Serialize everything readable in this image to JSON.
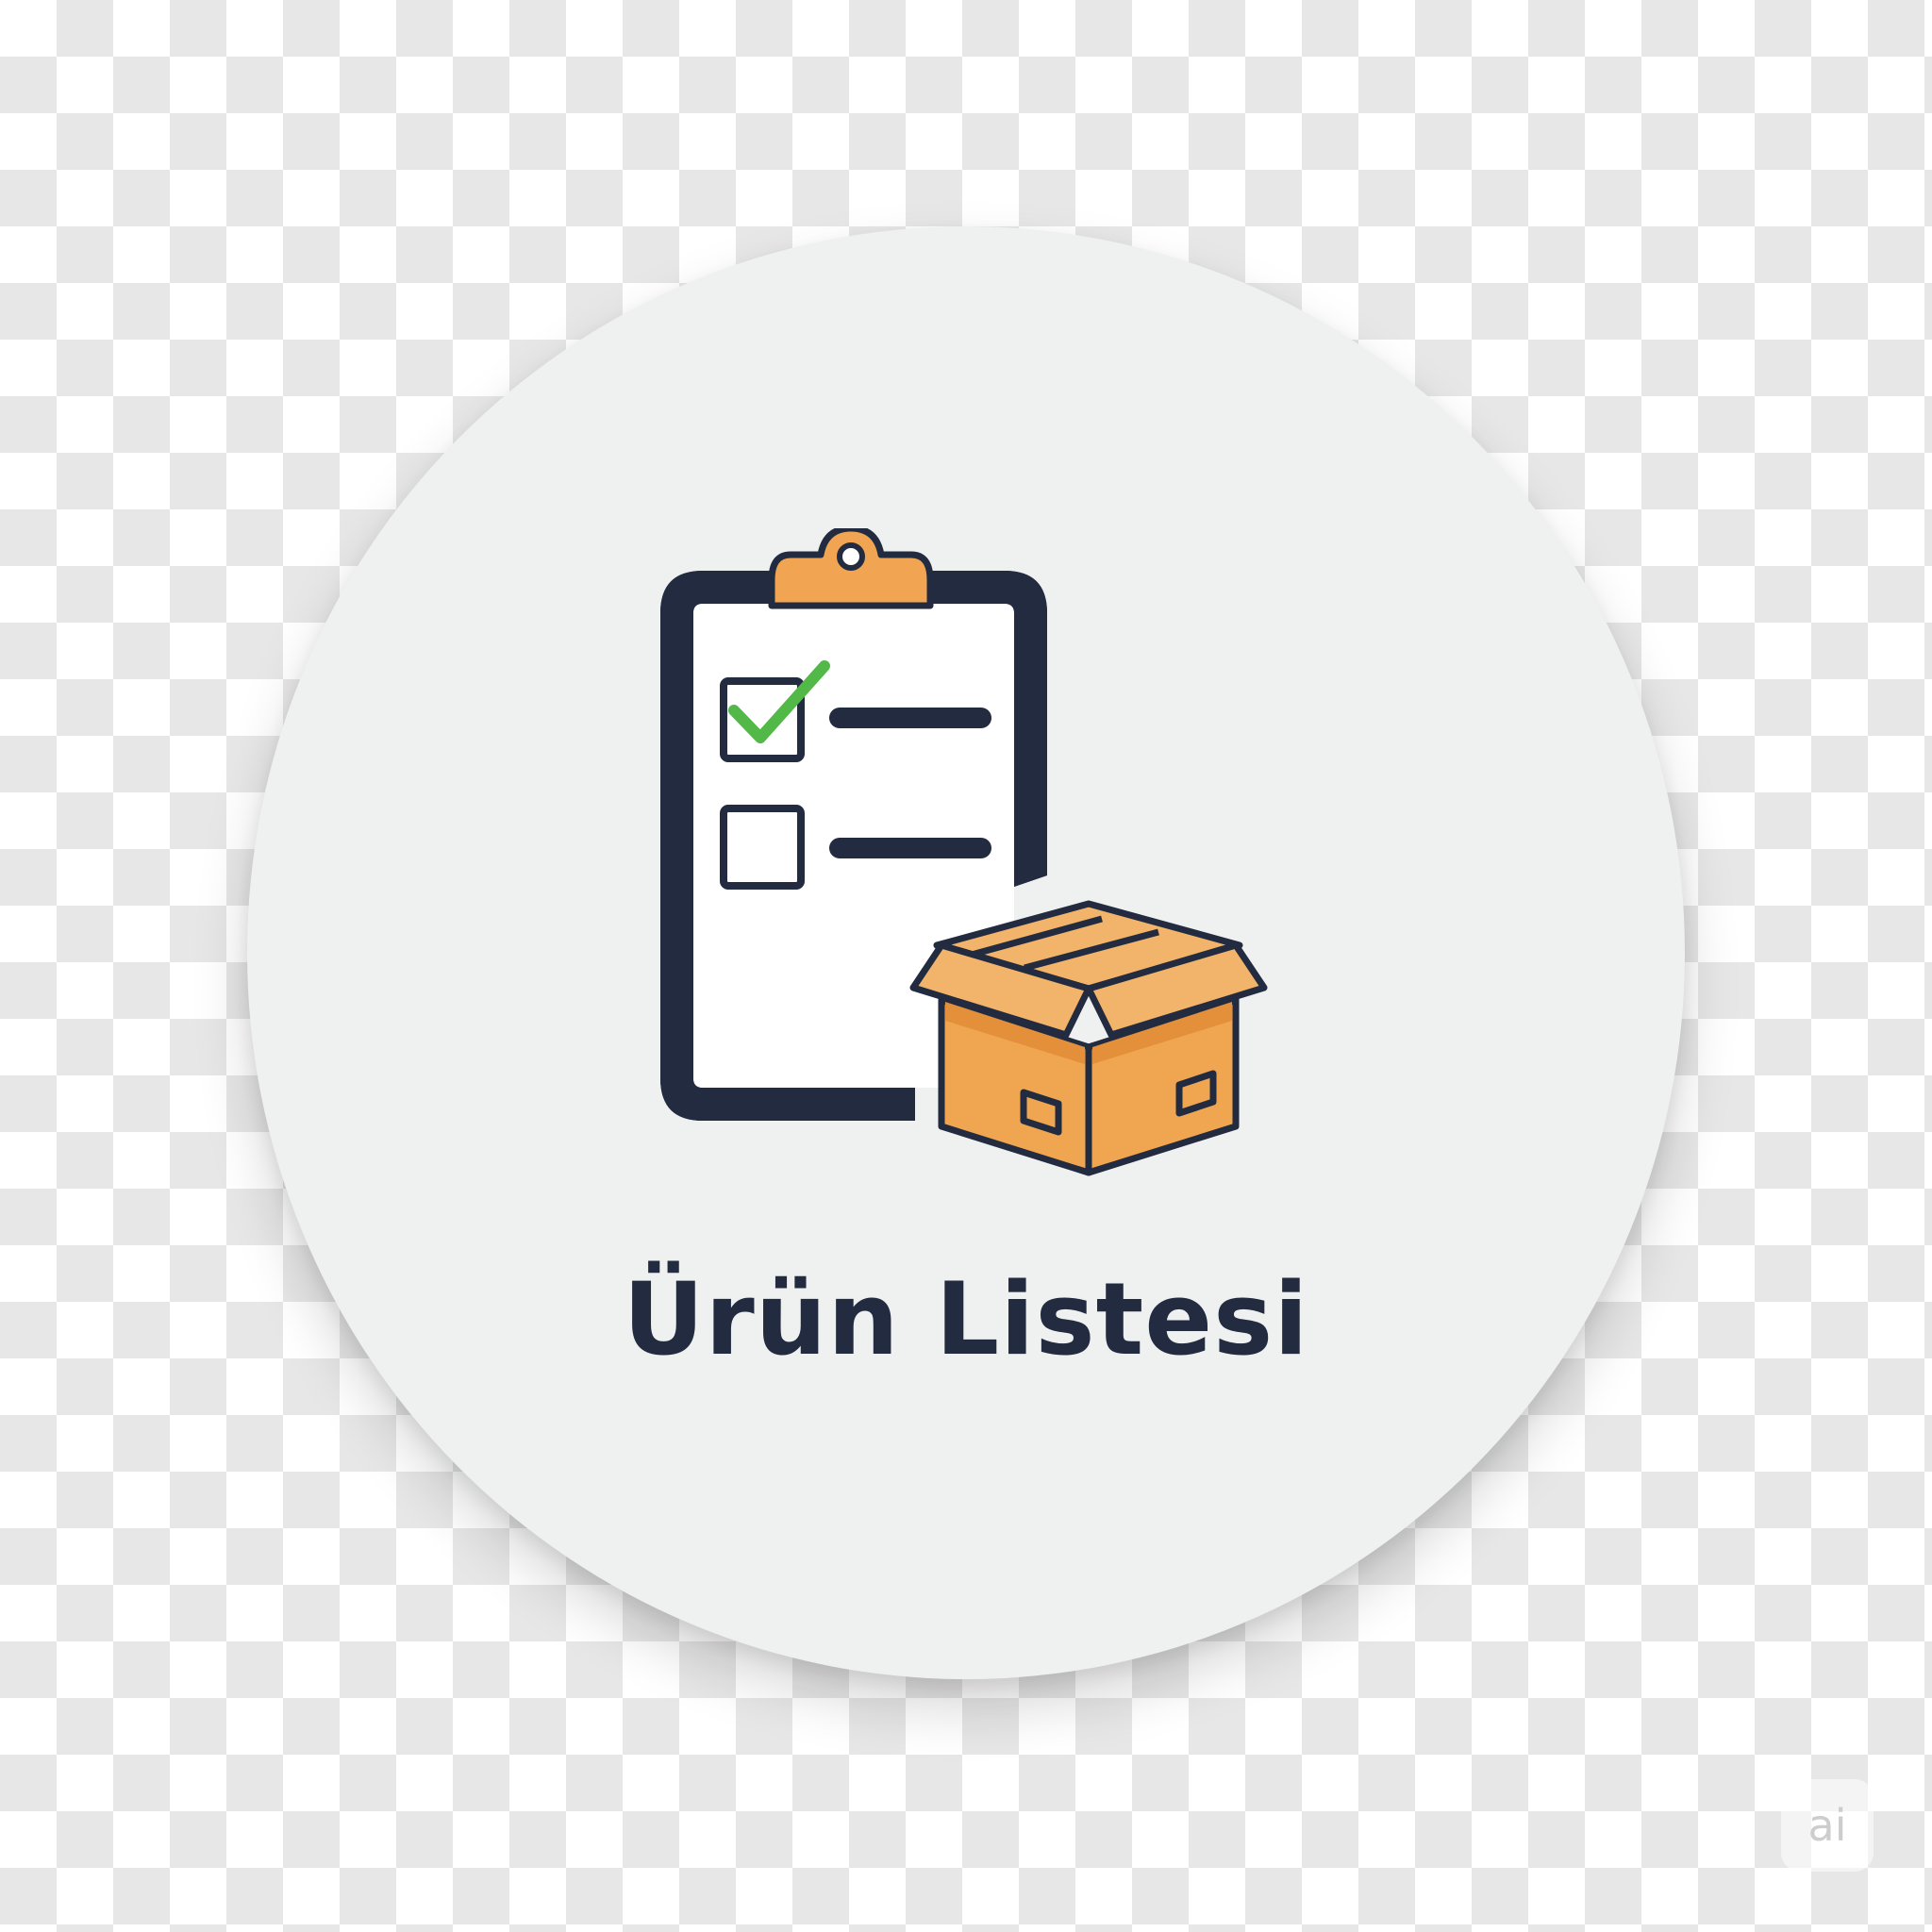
{
  "badge": {
    "title": "Ürün Listesi",
    "background_color": "#eff0f0",
    "text_color": "#222b3f"
  },
  "icon": {
    "name": "clipboard-checklist-with-box-icon",
    "colors": {
      "outline": "#222b3f",
      "clip": "#f1a553",
      "box": "#f0a650",
      "box_shade": "#e48f3a",
      "check": "#52b848"
    }
  },
  "watermark": {
    "text": "ai"
  }
}
